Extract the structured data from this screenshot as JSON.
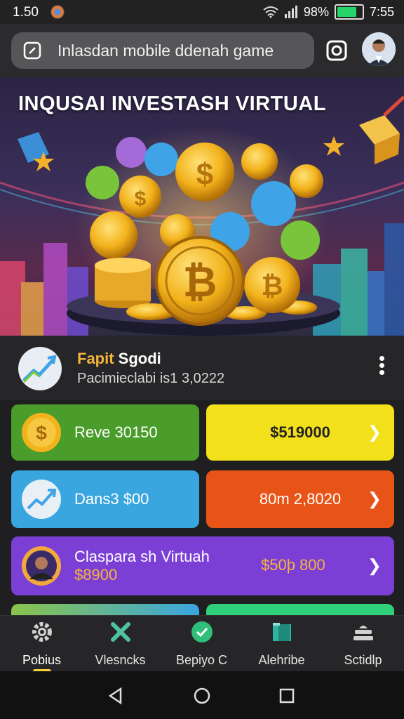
{
  "status_bar": {
    "time": "1.50",
    "right_text": "98%",
    "clock": "7:55",
    "battery_level": 0.9
  },
  "header": {
    "search_text": "Inlasdan mobile ddenah game",
    "icons": [
      "edit-icon",
      "camera-icon",
      "avatar"
    ]
  },
  "banner": {
    "title": "INQUSAI INVESTASH VIRTUAL"
  },
  "profit": {
    "title_highlight": "Fapit",
    "title_rest": " Sgodi",
    "subtitle": "Pacimieclabi is1 3,0222"
  },
  "cards": [
    {
      "label": "Reve 30150",
      "color": "#4a9d2a",
      "icon": "dollar-coin-icon"
    },
    {
      "value": "$519000",
      "color": "#f2e01a"
    },
    {
      "label": "Dans3 $00",
      "color": "#3aa6e0",
      "icon": "growth-chart-icon"
    },
    {
      "value": "80m 2,8020",
      "color": "#e85418"
    },
    {
      "label": "Claspara sh Virtuah",
      "sub": "$8900",
      "value": "$50þ 800",
      "color": "#7b3fd6",
      "icon": "person-icon"
    }
  ],
  "nav": [
    {
      "label": "Pobius",
      "icon": "gear-icon",
      "active": true
    },
    {
      "label": "Vlesncks",
      "icon": "tools-icon"
    },
    {
      "label": "Bepiyo C",
      "icon": "check-icon"
    },
    {
      "label": "Alehribe",
      "icon": "briefcase-icon"
    },
    {
      "label": "Sctidlp",
      "icon": "stack-icon"
    }
  ],
  "colors": {
    "accent": "#f4b53c",
    "background": "#1f1f21"
  }
}
